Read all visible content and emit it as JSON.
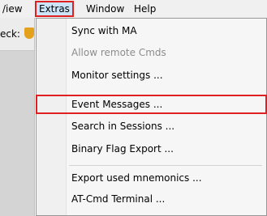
{
  "menubar": {
    "items": [
      {
        "label": "/iew"
      },
      {
        "label": "Extras"
      },
      {
        "label": "Window"
      },
      {
        "label": "Help"
      }
    ]
  },
  "left_panel": {
    "label": "eck:"
  },
  "extras_menu": {
    "items": [
      {
        "label": "Sync with MA",
        "enabled": true
      },
      {
        "label": "Allow remote Cmds",
        "enabled": false
      },
      {
        "label": "Monitor settings ...",
        "enabled": true
      },
      {
        "label": "Event Messages ...",
        "enabled": true,
        "highlighted": true
      },
      {
        "label": "Search in Sessions ...",
        "enabled": true
      },
      {
        "label": "Binary Flag Export ...",
        "enabled": true
      },
      {
        "label": "Export used mnemonics ...",
        "enabled": true
      },
      {
        "label": "AT-Cmd Terminal ...",
        "enabled": true
      }
    ]
  },
  "colors": {
    "highlight_outline": "#e02020",
    "menu_active_bg": "#cce4f7"
  }
}
